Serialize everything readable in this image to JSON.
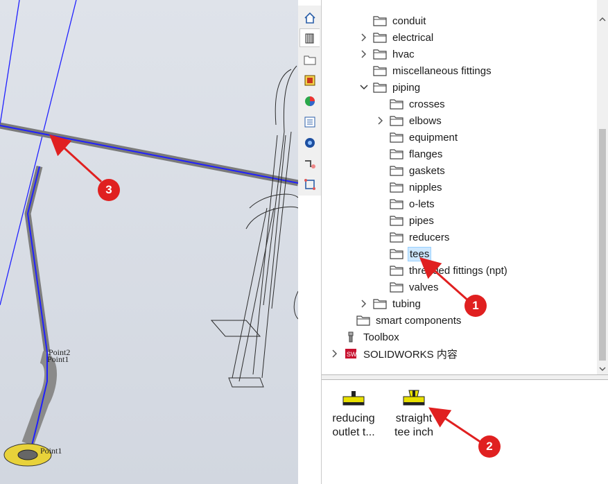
{
  "viewport": {
    "labels": {
      "point2": "Point2",
      "point1": "Point1",
      "point1b": "Point1"
    }
  },
  "tabs": [
    {
      "icon": "home-icon"
    },
    {
      "icon": "design-library-icon"
    },
    {
      "icon": "file-explorer-icon"
    },
    {
      "icon": "view-palette-icon"
    },
    {
      "icon": "appearances-icon"
    },
    {
      "icon": "custom-properties-icon"
    },
    {
      "icon": "solidworks-forum-icon"
    },
    {
      "icon": "routing-library-icon"
    },
    {
      "icon": "electrical-icon"
    }
  ],
  "tree": {
    "items": [
      {
        "label": "conduit",
        "level": 2,
        "expand": "none"
      },
      {
        "label": "electrical",
        "level": 2,
        "expand": "collapsed"
      },
      {
        "label": "hvac",
        "level": 2,
        "expand": "collapsed"
      },
      {
        "label": "miscellaneous fittings",
        "level": 2,
        "expand": "none"
      },
      {
        "label": "piping",
        "level": 2,
        "expand": "expanded"
      },
      {
        "label": "crosses",
        "level": 3,
        "expand": "none"
      },
      {
        "label": "elbows",
        "level": 3,
        "expand": "collapsed"
      },
      {
        "label": "equipment",
        "level": 3,
        "expand": "none"
      },
      {
        "label": "flanges",
        "level": 3,
        "expand": "none"
      },
      {
        "label": "gaskets",
        "level": 3,
        "expand": "none"
      },
      {
        "label": "nipples",
        "level": 3,
        "expand": "none"
      },
      {
        "label": "o-lets",
        "level": 3,
        "expand": "none"
      },
      {
        "label": "pipes",
        "level": 3,
        "expand": "none"
      },
      {
        "label": "reducers",
        "level": 3,
        "expand": "none"
      },
      {
        "label": "tees",
        "level": 3,
        "expand": "none",
        "selected": true
      },
      {
        "label": "threaded fittings (npt)",
        "level": 3,
        "expand": "none"
      },
      {
        "label": "valves",
        "level": 3,
        "expand": "none"
      },
      {
        "label": "tubing",
        "level": 2,
        "expand": "collapsed"
      },
      {
        "label": "smart components",
        "level": 1,
        "expand": "none"
      },
      {
        "label": "Toolbox",
        "level": 0,
        "expand": "none",
        "icon": "toolbox-icon"
      },
      {
        "label": "SOLIDWORKS 内容",
        "level": 0,
        "expand": "collapsed",
        "icon": "solidworks-content-icon"
      }
    ]
  },
  "palette": {
    "items": [
      {
        "line1": "reducing",
        "line2": "outlet t..."
      },
      {
        "line1": "straight",
        "line2": "tee inch"
      }
    ]
  },
  "callouts": [
    "1",
    "2",
    "3"
  ],
  "colors": {
    "accent_red": "#e02020",
    "sketch_blue": "#0000ff",
    "selection": "#cde8ff"
  }
}
